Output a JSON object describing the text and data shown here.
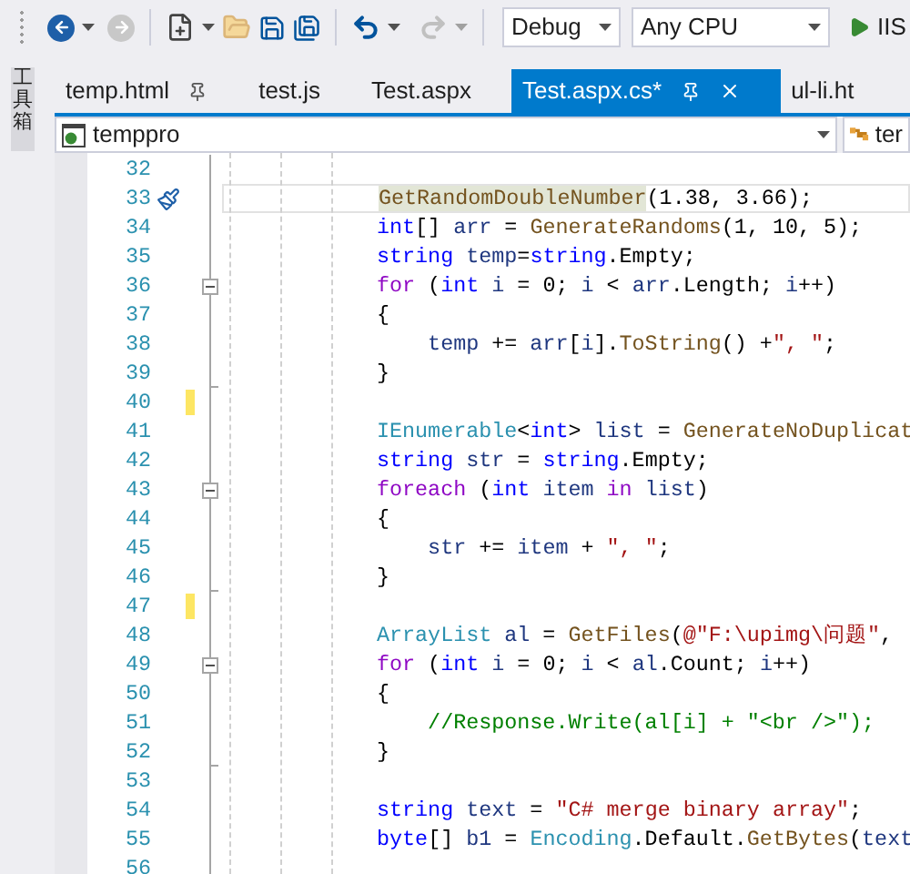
{
  "toolbar": {
    "configuration": "Debug",
    "platform": "Any CPU",
    "run_label": "IIS",
    "back_enabled": true,
    "forward_enabled": false,
    "undo_enabled": true,
    "redo_enabled": false
  },
  "toolbox_label": "工具箱",
  "tabs": [
    {
      "label": "temp.html",
      "selected": false,
      "pinned": true
    },
    {
      "label": "test.js",
      "selected": false,
      "pinned": false
    },
    {
      "label": "Test.aspx",
      "selected": false,
      "pinned": false
    },
    {
      "label": "Test.aspx.cs*",
      "selected": true,
      "pinned": true
    },
    {
      "label": "ul-li.ht",
      "selected": false,
      "pinned": false
    }
  ],
  "navigation": {
    "project": "temppro",
    "member": "ter"
  },
  "editor": {
    "lines": [
      {
        "number": "32",
        "current": false,
        "changed": false,
        "quick_action": false,
        "collapsible": false,
        "block_end": false
      },
      {
        "number": "33",
        "current": true,
        "changed": false,
        "quick_action": true,
        "collapsible": false,
        "block_end": false,
        "tokens": [
          {
            "kind": "ref",
            "text": "GetRandomDoubleNumber"
          },
          {
            "kind": "p",
            "text": "(1.38, 3.66);"
          }
        ]
      },
      {
        "number": "34",
        "current": false,
        "changed": false,
        "quick_action": false,
        "collapsible": false,
        "block_end": false,
        "tokens": [
          {
            "kind": "kw",
            "text": "int"
          },
          {
            "kind": "p",
            "text": "[] "
          },
          {
            "kind": "id",
            "text": "arr"
          },
          {
            "kind": "p",
            "text": " = "
          },
          {
            "kind": "method",
            "text": "GenerateRandoms"
          },
          {
            "kind": "p",
            "text": "(1, 10, 5);"
          }
        ]
      },
      {
        "number": "35",
        "current": false,
        "changed": false,
        "quick_action": false,
        "collapsible": false,
        "block_end": false,
        "tokens": [
          {
            "kind": "kw",
            "text": "string"
          },
          {
            "kind": "id",
            "text": " temp"
          },
          {
            "kind": "p",
            "text": "="
          },
          {
            "kind": "kw",
            "text": "string"
          },
          {
            "kind": "p",
            "text": ".Empty;"
          }
        ]
      },
      {
        "number": "36",
        "current": false,
        "changed": false,
        "quick_action": false,
        "collapsible": true,
        "block_end": false,
        "tokens": [
          {
            "kind": "ctl",
            "text": "for"
          },
          {
            "kind": "p",
            "text": " ("
          },
          {
            "kind": "kw",
            "text": "int"
          },
          {
            "kind": "id",
            "text": " i"
          },
          {
            "kind": "p",
            "text": " = 0; "
          },
          {
            "kind": "id",
            "text": "i"
          },
          {
            "kind": "p",
            "text": " < "
          },
          {
            "kind": "id",
            "text": "arr"
          },
          {
            "kind": "p",
            "text": ".Length; "
          },
          {
            "kind": "id",
            "text": "i"
          },
          {
            "kind": "p",
            "text": "++)"
          }
        ]
      },
      {
        "number": "37",
        "current": false,
        "changed": false,
        "quick_action": false,
        "collapsible": false,
        "block_end": false,
        "tokens": [
          {
            "kind": "p",
            "text": "{"
          }
        ]
      },
      {
        "number": "38",
        "current": false,
        "changed": false,
        "quick_action": false,
        "collapsible": false,
        "block_end": false,
        "tokens": [
          {
            "kind": "id",
            "text": "    temp"
          },
          {
            "kind": "p",
            "text": " += "
          },
          {
            "kind": "id",
            "text": "arr"
          },
          {
            "kind": "p",
            "text": "["
          },
          {
            "kind": "id",
            "text": "i"
          },
          {
            "kind": "p",
            "text": "]."
          },
          {
            "kind": "method",
            "text": "ToString"
          },
          {
            "kind": "p",
            "text": "() +"
          },
          {
            "kind": "str",
            "text": "\", \""
          },
          {
            "kind": "p",
            "text": ";"
          }
        ]
      },
      {
        "number": "39",
        "current": false,
        "changed": false,
        "quick_action": false,
        "collapsible": false,
        "block_end": true,
        "tokens": [
          {
            "kind": "p",
            "text": "}"
          }
        ]
      },
      {
        "number": "40",
        "current": false,
        "changed": true,
        "quick_action": false,
        "collapsible": false,
        "block_end": false
      },
      {
        "number": "41",
        "current": false,
        "changed": false,
        "quick_action": false,
        "collapsible": false,
        "block_end": false,
        "tokens": [
          {
            "kind": "type",
            "text": "IEnumerable"
          },
          {
            "kind": "p",
            "text": "<"
          },
          {
            "kind": "kw",
            "text": "int"
          },
          {
            "kind": "p",
            "text": "> "
          },
          {
            "kind": "id",
            "text": "list"
          },
          {
            "kind": "p",
            "text": " = "
          },
          {
            "kind": "method",
            "text": "GenerateNoDuplicat"
          }
        ]
      },
      {
        "number": "42",
        "current": false,
        "changed": false,
        "quick_action": false,
        "collapsible": false,
        "block_end": false,
        "tokens": [
          {
            "kind": "kw",
            "text": "string"
          },
          {
            "kind": "id",
            "text": " str"
          },
          {
            "kind": "p",
            "text": " = "
          },
          {
            "kind": "kw",
            "text": "string"
          },
          {
            "kind": "p",
            "text": ".Empty;"
          }
        ]
      },
      {
        "number": "43",
        "current": false,
        "changed": false,
        "quick_action": false,
        "collapsible": true,
        "block_end": false,
        "tokens": [
          {
            "kind": "ctl",
            "text": "foreach"
          },
          {
            "kind": "p",
            "text": " ("
          },
          {
            "kind": "kw",
            "text": "int"
          },
          {
            "kind": "id",
            "text": " item"
          },
          {
            "kind": "ctl",
            "text": " in"
          },
          {
            "kind": "id",
            "text": " list"
          },
          {
            "kind": "p",
            "text": ")"
          }
        ]
      },
      {
        "number": "44",
        "current": false,
        "changed": false,
        "quick_action": false,
        "collapsible": false,
        "block_end": false,
        "tokens": [
          {
            "kind": "p",
            "text": "{"
          }
        ]
      },
      {
        "number": "45",
        "current": false,
        "changed": false,
        "quick_action": false,
        "collapsible": false,
        "block_end": false,
        "tokens": [
          {
            "kind": "id",
            "text": "    str"
          },
          {
            "kind": "p",
            "text": " += "
          },
          {
            "kind": "id",
            "text": "item"
          },
          {
            "kind": "p",
            "text": " + "
          },
          {
            "kind": "str",
            "text": "\", \""
          },
          {
            "kind": "p",
            "text": ";"
          }
        ]
      },
      {
        "number": "46",
        "current": false,
        "changed": false,
        "quick_action": false,
        "collapsible": false,
        "block_end": true,
        "tokens": [
          {
            "kind": "p",
            "text": "}"
          }
        ]
      },
      {
        "number": "47",
        "current": false,
        "changed": true,
        "quick_action": false,
        "collapsible": false,
        "block_end": false
      },
      {
        "number": "48",
        "current": false,
        "changed": false,
        "quick_action": false,
        "collapsible": false,
        "block_end": false,
        "tokens": [
          {
            "kind": "type",
            "text": "ArrayList"
          },
          {
            "kind": "id",
            "text": " al"
          },
          {
            "kind": "p",
            "text": " = "
          },
          {
            "kind": "method",
            "text": "GetFiles"
          },
          {
            "kind": "p",
            "text": "("
          },
          {
            "kind": "str",
            "text": "@\"F:\\upimg\\问题\""
          },
          {
            "kind": "p",
            "text": ","
          }
        ]
      },
      {
        "number": "49",
        "current": false,
        "changed": false,
        "quick_action": false,
        "collapsible": true,
        "block_end": false,
        "tokens": [
          {
            "kind": "ctl",
            "text": "for"
          },
          {
            "kind": "p",
            "text": " ("
          },
          {
            "kind": "kw",
            "text": "int"
          },
          {
            "kind": "id",
            "text": " i"
          },
          {
            "kind": "p",
            "text": " = 0; "
          },
          {
            "kind": "id",
            "text": "i"
          },
          {
            "kind": "p",
            "text": " < "
          },
          {
            "kind": "id",
            "text": "al"
          },
          {
            "kind": "p",
            "text": ".Count; "
          },
          {
            "kind": "id",
            "text": "i"
          },
          {
            "kind": "p",
            "text": "++)"
          }
        ]
      },
      {
        "number": "50",
        "current": false,
        "changed": false,
        "quick_action": false,
        "collapsible": false,
        "block_end": false,
        "tokens": [
          {
            "kind": "p",
            "text": "{"
          }
        ]
      },
      {
        "number": "51",
        "current": false,
        "changed": false,
        "quick_action": false,
        "collapsible": false,
        "block_end": false,
        "tokens": [
          {
            "kind": "comment",
            "text": "    //Response.Write(al[i] + \"<br />\");"
          }
        ]
      },
      {
        "number": "52",
        "current": false,
        "changed": false,
        "quick_action": false,
        "collapsible": false,
        "block_end": true,
        "tokens": [
          {
            "kind": "p",
            "text": "}"
          }
        ]
      },
      {
        "number": "53",
        "current": false,
        "changed": false,
        "quick_action": false,
        "collapsible": false,
        "block_end": false
      },
      {
        "number": "54",
        "current": false,
        "changed": false,
        "quick_action": false,
        "collapsible": false,
        "block_end": false,
        "tokens": [
          {
            "kind": "kw",
            "text": "string"
          },
          {
            "kind": "id",
            "text": " text"
          },
          {
            "kind": "p",
            "text": " = "
          },
          {
            "kind": "str",
            "text": "\"C# merge binary array\""
          },
          {
            "kind": "p",
            "text": ";"
          }
        ]
      },
      {
        "number": "55",
        "current": false,
        "changed": false,
        "quick_action": false,
        "collapsible": false,
        "block_end": false,
        "tokens": [
          {
            "kind": "kw",
            "text": "byte"
          },
          {
            "kind": "p",
            "text": "[] "
          },
          {
            "kind": "id",
            "text": "b1"
          },
          {
            "kind": "p",
            "text": " = "
          },
          {
            "kind": "type",
            "text": "Encoding"
          },
          {
            "kind": "p",
            "text": ".Default."
          },
          {
            "kind": "method",
            "text": "GetBytes"
          },
          {
            "kind": "p",
            "text": "("
          },
          {
            "kind": "id",
            "text": "text"
          }
        ]
      },
      {
        "number": "56",
        "current": false,
        "changed": false,
        "quick_action": false,
        "collapsible": false,
        "block_end": false
      }
    ]
  }
}
